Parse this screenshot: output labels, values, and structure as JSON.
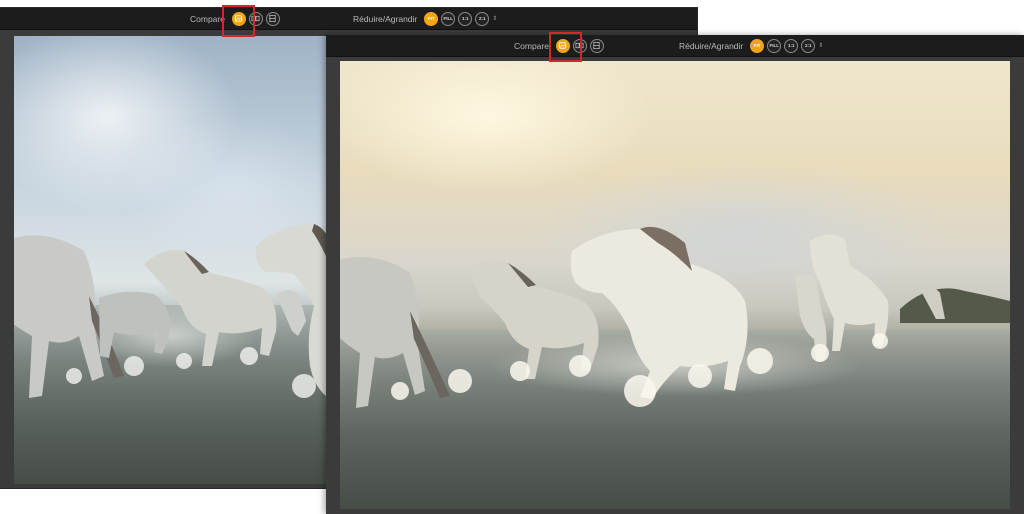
{
  "toolbar": {
    "compare_label": "Compare",
    "zoom_label": "Réduire/Agrandir",
    "zoom_options": [
      "FIT",
      "FILL",
      "1:1",
      "2:1"
    ],
    "active_zoom": "FIT",
    "updown_glyph": "⇕"
  },
  "compare_buttons": [
    {
      "icon": "single-view-icon",
      "active": true
    },
    {
      "icon": "side-by-side-icon",
      "active": false
    },
    {
      "icon": "split-view-icon",
      "active": false
    }
  ],
  "colors": {
    "accent": "#f0a516",
    "highlight": "#d6262b",
    "toolbar_bg": "#1c1c1c",
    "panel_bg": "#3b3b3b"
  },
  "windows": [
    {
      "name": "before-window",
      "image": "horses-cool-tone"
    },
    {
      "name": "after-window",
      "image": "horses-warm-tone"
    }
  ]
}
